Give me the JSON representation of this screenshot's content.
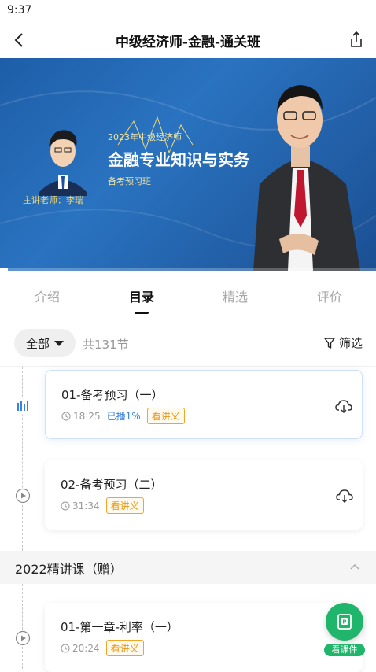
{
  "status_bar": {
    "time": "9:37"
  },
  "header": {
    "title": "中级经济师-金融-通关班"
  },
  "video": {
    "year_title": "2023年中级经济师",
    "course_title": "金融专业知识与实务",
    "class_label": "备考预习班",
    "teacher_label": "主讲老师：李瑞",
    "progress": 0.02
  },
  "tabs": [
    {
      "label": "介绍",
      "active": false
    },
    {
      "label": "目录",
      "active": true
    },
    {
      "label": "精选",
      "active": false
    },
    {
      "label": "评价",
      "active": false
    }
  ],
  "filter": {
    "all_label": "全部",
    "count_text": "共131节",
    "filter_label": "筛选"
  },
  "lessons": [
    {
      "title": "01-备考预习（一）",
      "duration": "18:25",
      "played": "已播1%",
      "notes": "看讲义",
      "status_icon": "playing-bars-icon"
    },
    {
      "title": "02-备考预习（二）",
      "duration": "31:34",
      "played": "",
      "notes": "看讲义",
      "status_icon": "play-circle-icon"
    }
  ],
  "section": {
    "title": "2022精讲课（赠）",
    "expanded": true
  },
  "section_lessons": [
    {
      "title": "01-第一章-利率（一）",
      "duration": "20:24",
      "notes": "看讲义",
      "status_icon": "play-circle-icon"
    }
  ],
  "fab": {
    "label": "看课件"
  },
  "colors": {
    "accent_blue": "#3b82e0",
    "badge_orange": "#e99512",
    "fab_green": "#1fb56a",
    "video_blue": "#1e5ea8"
  }
}
